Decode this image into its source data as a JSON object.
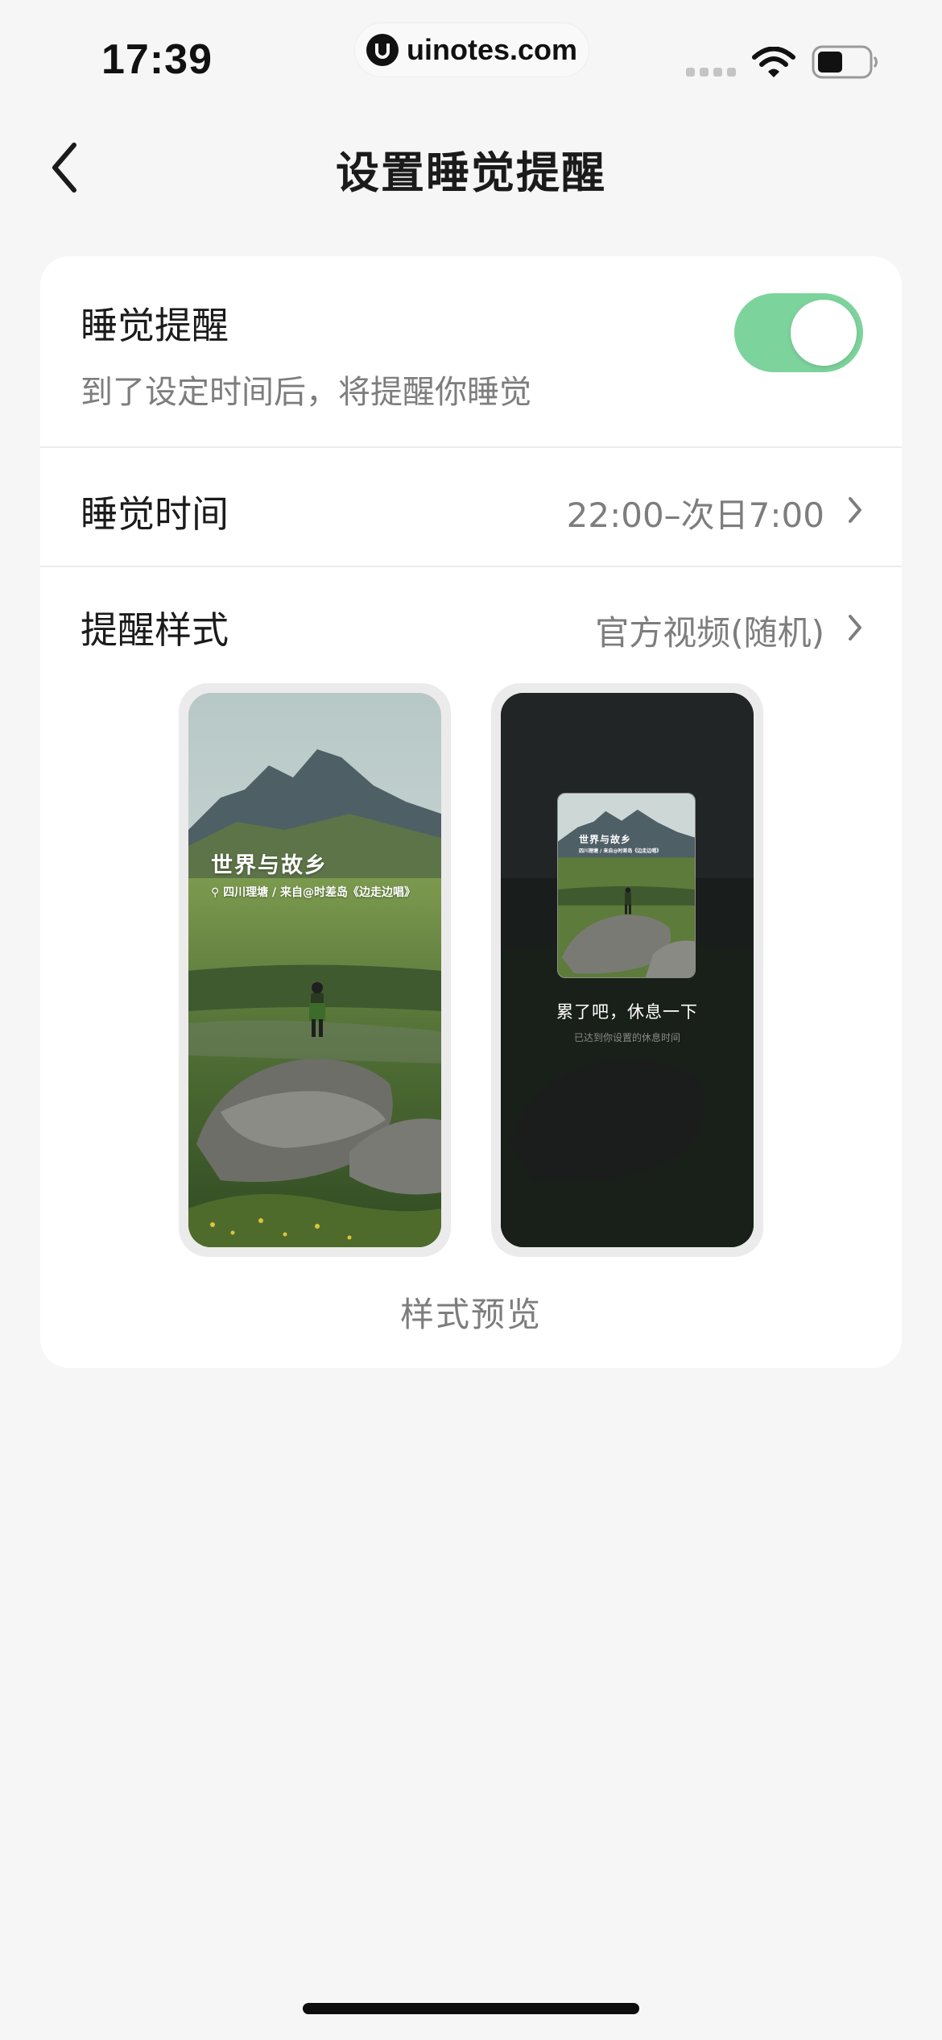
{
  "status_bar": {
    "time": "17:39",
    "url": "uinotes.com",
    "icons": [
      "signal-icon",
      "wifi-icon",
      "battery-icon"
    ]
  },
  "nav": {
    "title": "设置睡觉提醒",
    "back_icon": "chevron-left-icon"
  },
  "sleep_reminder": {
    "title": "睡觉提醒",
    "subtitle": "到了设定时间后，将提醒你睡觉",
    "enabled": true,
    "toggle_color": "#7dd39c"
  },
  "sleep_time": {
    "label": "睡觉时间",
    "value": "22:00–次日7:00"
  },
  "reminder_style": {
    "label": "提醒样式",
    "value": "官方视频(随机)"
  },
  "previews": {
    "fullscreen": {
      "title": "世界与故乡",
      "caption": "四川理塘 / 来自@时差岛《边走边唱》"
    },
    "popup": {
      "title": "世界与故乡",
      "caption": "四川理塘 / 来自@时差岛《边走边唱》",
      "message": "累了吧，休息一下",
      "sub_message": "已达到你设置的休息时间"
    },
    "label": "样式预览"
  }
}
